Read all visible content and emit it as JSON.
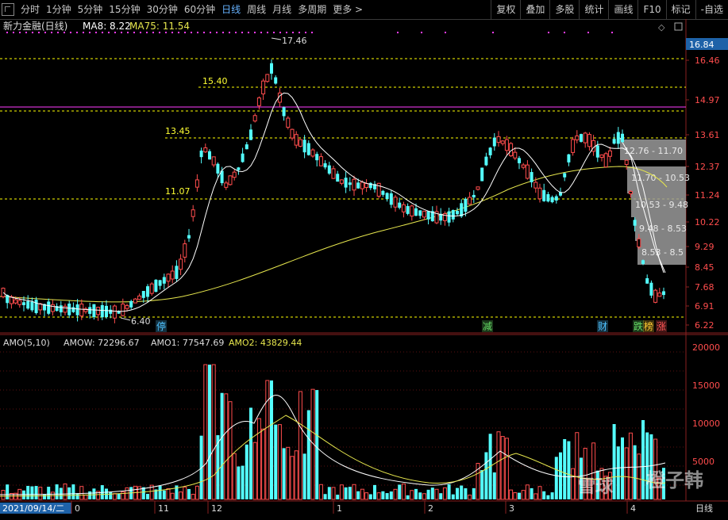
{
  "toolbar": {
    "tabs": [
      {
        "label": "分时",
        "active": false
      },
      {
        "label": "1分钟",
        "active": false
      },
      {
        "label": "5分钟",
        "active": false
      },
      {
        "label": "15分钟",
        "active": false
      },
      {
        "label": "30分钟",
        "active": false
      },
      {
        "label": "60分钟",
        "active": false
      },
      {
        "label": "日线",
        "active": true
      },
      {
        "label": "周线",
        "active": false
      },
      {
        "label": "月线",
        "active": false
      },
      {
        "label": "多周期",
        "active": false
      },
      {
        "label": "更多 >",
        "active": false
      }
    ],
    "right_tabs": [
      "复权",
      "叠加",
      "多股",
      "统计",
      "画线",
      "F10",
      "标记",
      "-自选"
    ]
  },
  "main": {
    "stock_title": "新力金融(日线)",
    "ma8_label": "MA8: 8.22",
    "ma75_label": "MA75: 11.54",
    "current_price_tag": "16.84",
    "price_axis": [
      "16.46",
      "14.97",
      "13.61",
      "12.37",
      "11.24",
      "10.22",
      "9.29",
      "8.45",
      "7.68",
      "6.91",
      "6.22"
    ],
    "annotations": {
      "high": "17.46",
      "low": "6.40",
      "level_1540": "15.40",
      "level_1345": "13.45",
      "level_1107": "11.07"
    },
    "ranges": [
      "12.76 - 11.70",
      "11.70 - 10.53",
      "10.53 - 9.48",
      "9.48 - 8.53",
      "8.53 - 8.5"
    ],
    "markers": [
      {
        "text": "停",
        "color": "#4fc3ff"
      },
      {
        "text": "减",
        "color": "#66dd66"
      },
      {
        "text": "财",
        "color": "#4fc3ff"
      },
      {
        "text": "跌",
        "color": "#66dd66"
      },
      {
        "text": "榜",
        "color": "#ffcc33"
      },
      {
        "text": "涨",
        "color": "#ff5555"
      }
    ]
  },
  "volume": {
    "title": "AMO(5,10)",
    "amow_label": "AMOW: 72296.67",
    "amo1_label": "AMO1: 77547.69",
    "amo2_label": "AMO2: 43829.44",
    "axis": [
      "20000",
      "15000",
      "10000",
      "5000"
    ]
  },
  "x_axis": {
    "start_date": "2021/09/14/二",
    "ticks": [
      "0",
      "11",
      "12",
      "1",
      "2",
      "3",
      "4"
    ],
    "period_label": "日线"
  },
  "watermark": {
    "left": "雪球",
    "right": "橙子韩"
  },
  "colors": {
    "up": "#ff4d4d",
    "down": "#54ffff",
    "ma8": "#ffffff",
    "ma75": "#e6e64d",
    "dash": "#ffff00",
    "magenta": "#ff3cff"
  }
}
